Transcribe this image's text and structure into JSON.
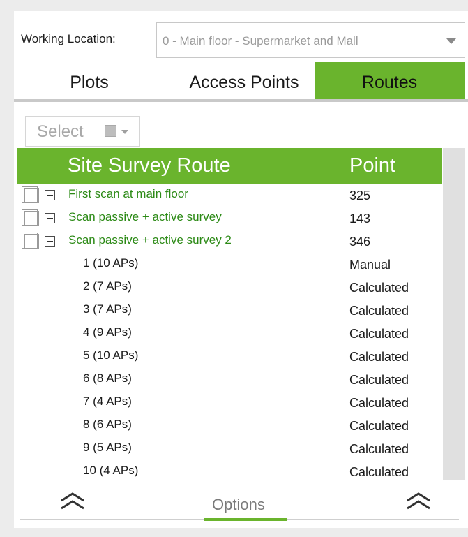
{
  "location": {
    "label": "Working Location:",
    "value": "0 - Main floor - Supermarket and Mall"
  },
  "tabs": [
    {
      "label": "Plots",
      "active": false
    },
    {
      "label": "Access Points",
      "active": false
    },
    {
      "label": "Routes",
      "active": true
    }
  ],
  "select": {
    "label": "Select"
  },
  "table": {
    "headers": {
      "route": "Site Survey Route",
      "point": "Point"
    },
    "routes": [
      {
        "name": "First scan at main floor",
        "point": "325",
        "expanded": false
      },
      {
        "name": "Scan passive + active survey",
        "point": "143",
        "expanded": false
      },
      {
        "name": "Scan passive + active survey 2",
        "point": "346",
        "expanded": true
      }
    ],
    "subrows": [
      {
        "name": "1 (10 APs)",
        "point": "Manual"
      },
      {
        "name": "2 (7 APs)",
        "point": "Calculated"
      },
      {
        "name": "3 (7 APs)",
        "point": "Calculated"
      },
      {
        "name": "4 (9 APs)",
        "point": "Calculated"
      },
      {
        "name": "5 (10 APs)",
        "point": "Calculated"
      },
      {
        "name": "6 (8 APs)",
        "point": "Calculated"
      },
      {
        "name": "7 (4 APs)",
        "point": "Calculated"
      },
      {
        "name": "8 (6 APs)",
        "point": "Calculated"
      },
      {
        "name": "9 (5 APs)",
        "point": "Calculated"
      },
      {
        "name": "10 (4 APs)",
        "point": "Calculated"
      }
    ]
  },
  "footer": {
    "options_label": "Options"
  },
  "colors": {
    "accent": "#6ab42d",
    "route_text": "#2c8a16"
  },
  "icons": [
    "dropdown-arrow-icon",
    "checkbox-icon",
    "expand-plus-icon",
    "collapse-minus-icon",
    "double-chevron-up-icon"
  ]
}
